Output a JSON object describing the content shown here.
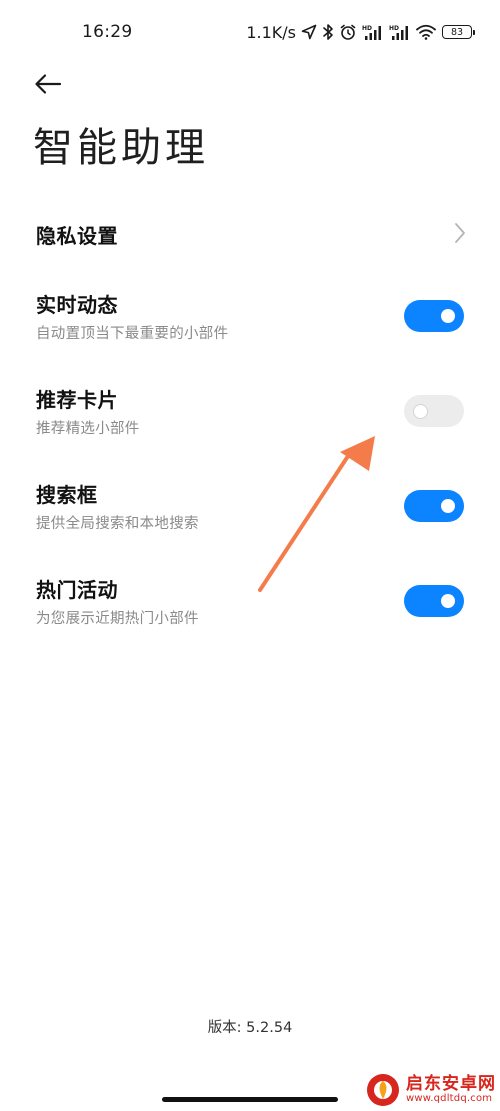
{
  "status_bar": {
    "time": "16:29",
    "network_speed": "1.1K/s",
    "battery": "83",
    "icons": [
      "location-arrow-icon",
      "bluetooth-icon",
      "alarm-icon",
      "signal-hd-icon",
      "signal-hd-icon",
      "wifi-icon",
      "battery-icon"
    ]
  },
  "header": {
    "back_icon": "arrow-left-icon",
    "title": "智能助理"
  },
  "settings": {
    "privacy": {
      "title": "隐私设置",
      "icon": "chevron-right-icon"
    },
    "items": [
      {
        "title": "实时动态",
        "subtitle": "自动置顶当下最重要的小部件",
        "enabled": true
      },
      {
        "title": "推荐卡片",
        "subtitle": "推荐精选小部件",
        "enabled": false
      },
      {
        "title": "搜索框",
        "subtitle": "提供全局搜索和本地搜索",
        "enabled": true
      },
      {
        "title": "热门活动",
        "subtitle": "为您展示近期热门小部件",
        "enabled": true
      }
    ]
  },
  "footer": {
    "version": "版本: 5.2.54"
  },
  "annotation": {
    "color": "#f47c4a",
    "icon": "arrow-annotation-icon"
  },
  "watermark": {
    "name": "启东安卓网",
    "url": "www.qdltdq.com",
    "color": "#d6261d"
  },
  "colors": {
    "toggle_on": "#0d84ff",
    "toggle_off": "#ececec"
  }
}
